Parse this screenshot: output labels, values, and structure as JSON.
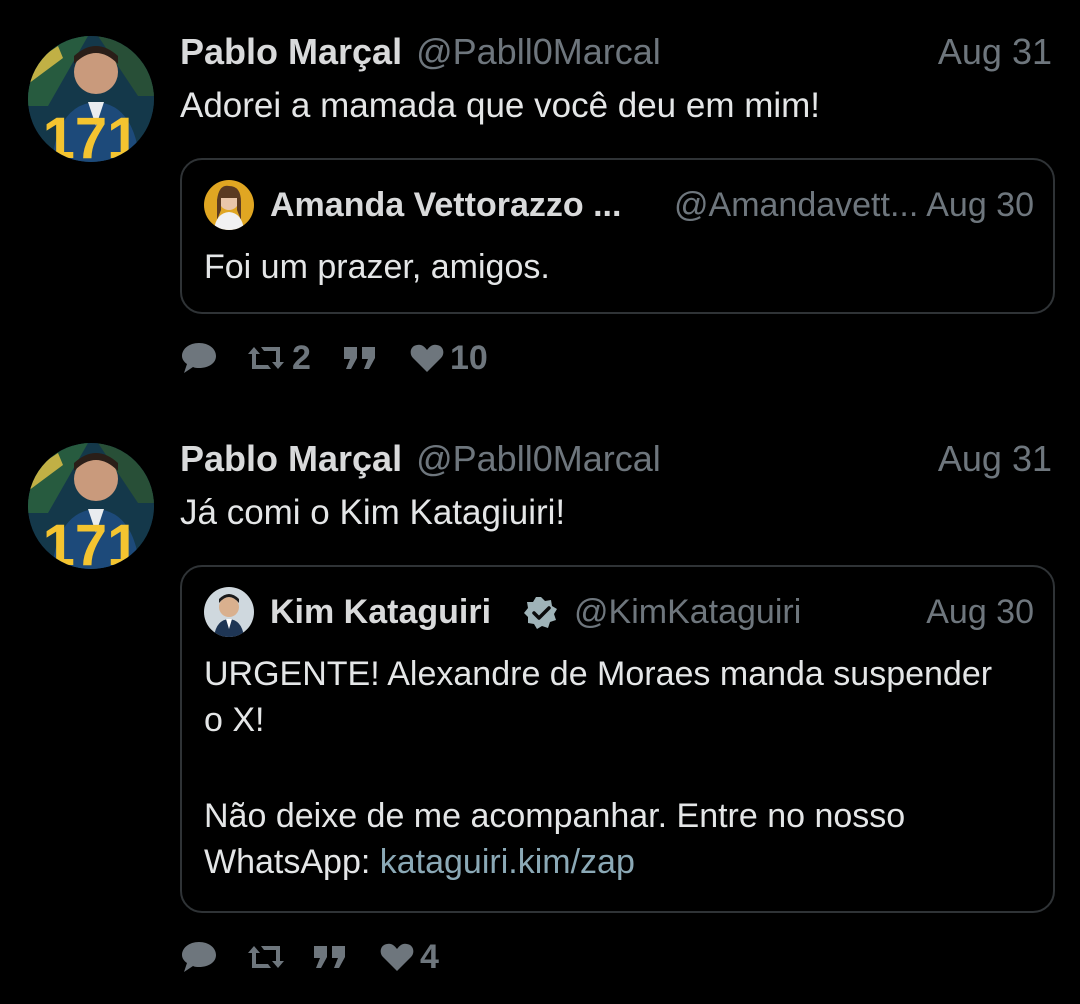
{
  "tweets": [
    {
      "author_name": "Pablo Marçal",
      "author_handle": "@Pabll0Marcal",
      "date": "Aug 31",
      "text": "Adorei a mamada que você deu em mim!",
      "avatar_badge": "171",
      "quote": {
        "author_name": "Amanda Vettorazzo ...",
        "author_handle": "@Amandavett...",
        "date": "Aug 30",
        "text": "Foi um prazer, amigos."
      },
      "actions": {
        "reply_icon": "reply-icon",
        "retweet_icon": "retweet-icon",
        "retweet_count": "2",
        "quote_icon": "quote-icon",
        "like_icon": "heart-icon",
        "like_count": "10"
      }
    },
    {
      "author_name": "Pablo Marçal",
      "author_handle": "@Pabll0Marcal",
      "date": "Aug 31",
      "text": "Já comi o Kim Katagiuiri!",
      "avatar_badge": "171",
      "quote": {
        "author_name": "Kim Kataguiri",
        "verified_icon": "verified-badge-icon",
        "author_handle": "@KimKataguiri",
        "date": "Aug 30",
        "text_line1": "URGENTE! Alexandre de Moraes manda suspender",
        "text_line2": "o X!",
        "text_line3": "Não deixe de me acompanhar. Entre no nosso",
        "text_line4_prefix": "WhatsApp: ",
        "link": "kataguiri.kim/zap"
      },
      "actions": {
        "reply_icon": "reply-icon",
        "retweet_icon": "retweet-icon",
        "quote_icon": "quote-icon",
        "like_icon": "heart-icon",
        "like_count": "4"
      }
    }
  ],
  "colors": {
    "background": "#000000",
    "text": "#e4e6e7",
    "muted": "#6e767d",
    "border": "#2f3336",
    "link": "#8ba9b6",
    "badge_yellow": "#f4c430"
  }
}
